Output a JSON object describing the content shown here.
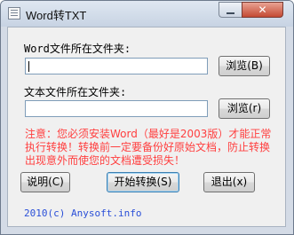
{
  "window": {
    "title": "Word转TXT",
    "close_glyph": "✕",
    "icons": [
      "app-icon",
      "minimize-icon",
      "close-icon"
    ]
  },
  "form": {
    "word_folder_label": "Word文件所在文件夹:",
    "word_folder_value": "",
    "browse_b_label": "浏览(B)",
    "text_folder_label": "文本文件所在文件夹:",
    "text_folder_value": "",
    "browse_r_label": "浏览(r)"
  },
  "warning": "注意：您必须安装Word（最好是2003版）才能正常执行转换！转换前一定要备份好原始文档，防止转换出现意外而使您的文档遭受损失！",
  "buttons": {
    "help_label": "说明(C)",
    "start_label": "开始转换(S)",
    "exit_label": "退出(x)"
  },
  "footer": {
    "copyright": "2010(c) Anysoft.info"
  },
  "colors": {
    "warning": "#ff3f3f",
    "copyright": "#2a4fd8"
  }
}
